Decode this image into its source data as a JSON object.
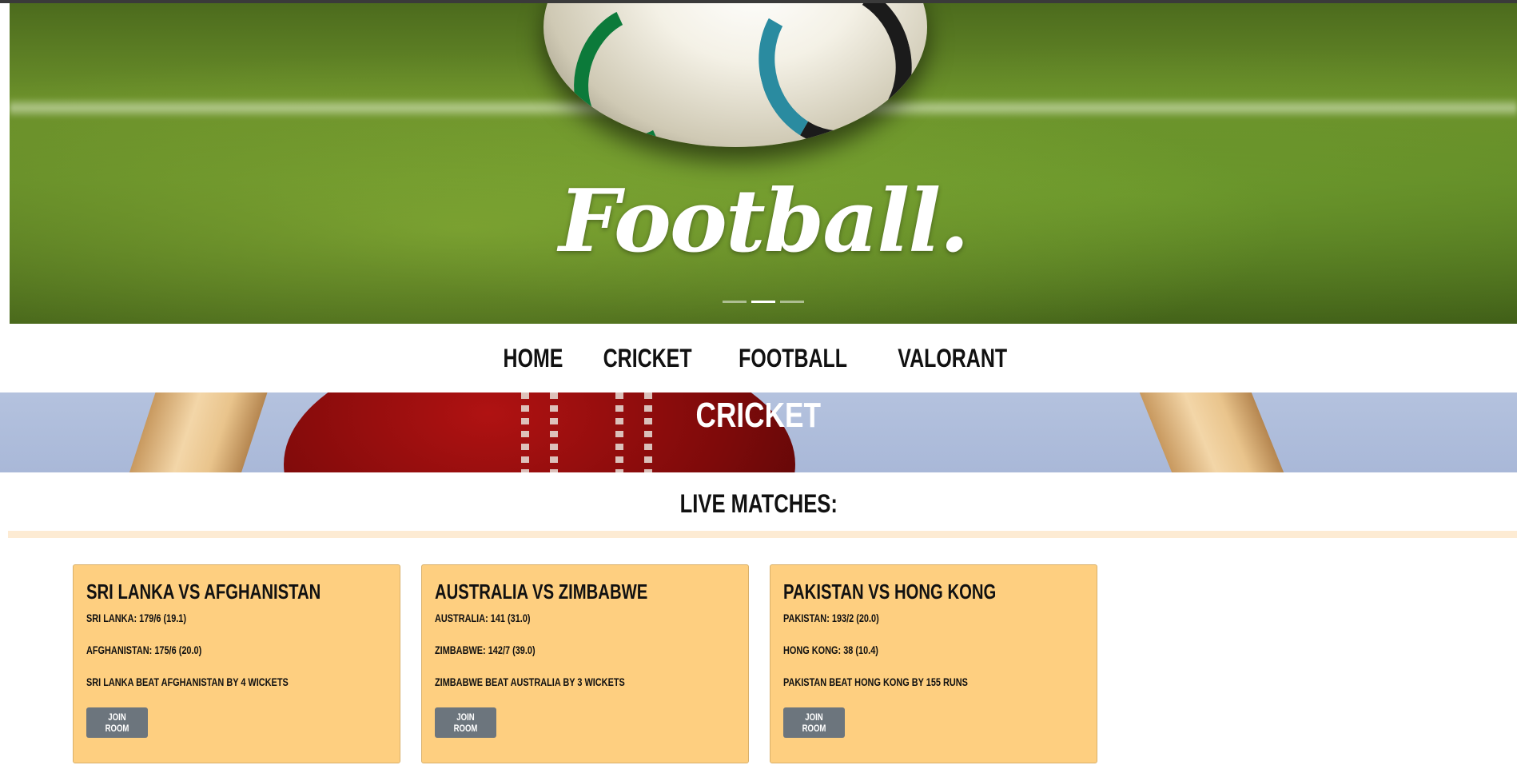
{
  "hero": {
    "title": "Football.",
    "indicators": [
      {
        "label": "slide 1",
        "active": false
      },
      {
        "label": "slide 2",
        "active": true
      },
      {
        "label": "slide 3",
        "active": false
      }
    ]
  },
  "nav": {
    "items": [
      {
        "label": "HOME"
      },
      {
        "label": "CRICKET"
      },
      {
        "label": "FOOTBALL"
      },
      {
        "label": "VALORANT"
      }
    ]
  },
  "banner": {
    "title": "CRICKET"
  },
  "live": {
    "heading": "LIVE MATCHES:",
    "matches": [
      {
        "title": "SRI LANKA VS AFGHANISTAN",
        "team1": "SRI LANKA: 179/6 (19.1)",
        "team2": "AFGHANISTAN: 175/6 (20.0)",
        "result": "SRI LANKA BEAT AFGHANISTAN BY 4 WICKETS",
        "button": "JOIN ROOM"
      },
      {
        "title": "AUSTRALIA VS ZIMBABWE",
        "team1": "AUSTRALIA: 141 (31.0)",
        "team2": "ZIMBABWE: 142/7 (39.0)",
        "result": "ZIMBABWE BEAT AUSTRALIA BY 3 WICKETS",
        "button": "JOIN ROOM"
      },
      {
        "title": "PAKISTAN VS HONG KONG",
        "team1": "PAKISTAN: 193/2 (20.0)",
        "team2": "HONG KONG: 38 (10.4)",
        "result": "PAKISTAN BEAT HONG KONG BY 155 RUNS",
        "button": "JOIN ROOM"
      }
    ]
  },
  "colors": {
    "card_bg": "#fecf80",
    "button_bg": "#6c757d",
    "divider": "#fdebd3"
  }
}
